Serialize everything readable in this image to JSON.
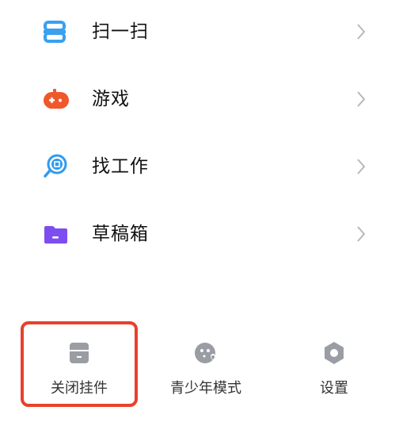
{
  "menu": {
    "items": [
      {
        "label": "扫一扫",
        "icon": "scan-icon"
      },
      {
        "label": "游戏",
        "icon": "gamepad-icon"
      },
      {
        "label": "找工作",
        "icon": "job-search-icon"
      },
      {
        "label": "草稿箱",
        "icon": "draft-folder-icon"
      },
      {
        "label": "",
        "icon": "folder-icon"
      }
    ]
  },
  "bottom_bar": {
    "tabs": [
      {
        "label": "关闭挂件",
        "icon": "widget-icon"
      },
      {
        "label": "青少年模式",
        "icon": "youth-mode-icon"
      },
      {
        "label": "设置",
        "icon": "settings-icon"
      }
    ]
  },
  "colors": {
    "scan": "#3aa0f0",
    "game": "#f0582a",
    "job": "#2f9bf0",
    "draft": "#7d4df0",
    "folder": "#f2b52a",
    "bottom_icon": "#9a9da3",
    "highlight": "#e8412c"
  }
}
